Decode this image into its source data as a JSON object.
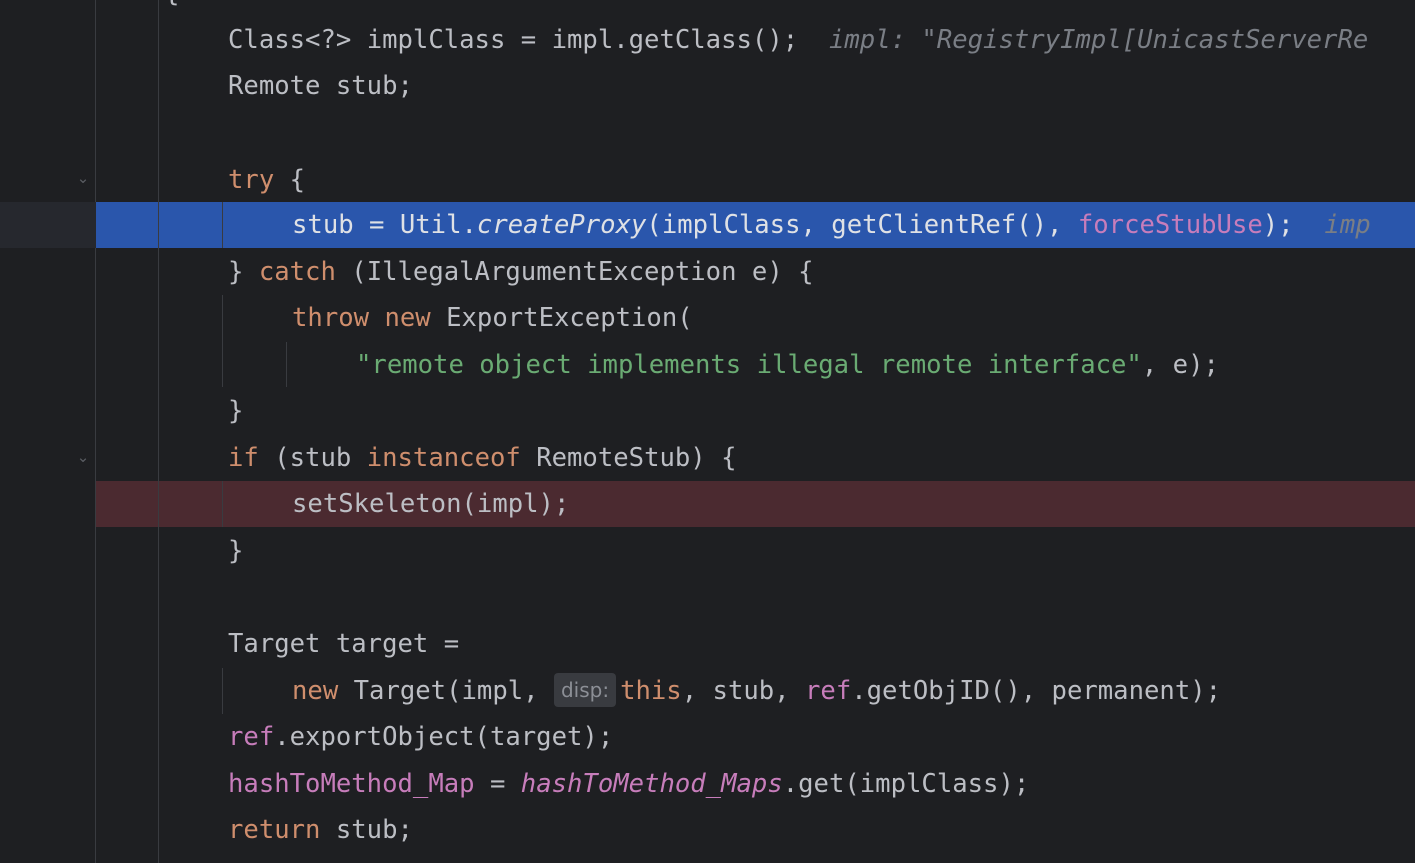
{
  "code": {
    "line_class_decl": {
      "type": "Class<?>",
      "name": " implClass = impl.getClass();",
      "debug_hint": "impl: \"RegistryImpl[UnicastServerRe"
    },
    "line_remote_stub": "Remote stub;",
    "line_try": {
      "kw": "try",
      "rest": " {"
    },
    "line_create_proxy": {
      "prefix": "stub = Util.",
      "method": "createProxy",
      "args": "(implClass, getClientRef(), ",
      "field": "forceStubUse",
      "suffix": ");",
      "debug_hint": "imp"
    },
    "line_catch": {
      "pre": "} ",
      "kw": "catch",
      "rest": " (IllegalArgumentException e) {"
    },
    "line_throw": {
      "kw1": "throw",
      "kw2": "new",
      "rest": " ExportException("
    },
    "line_string": {
      "str": "\"remote object implements illegal remote interface\"",
      "rest": ", e);"
    },
    "line_close1": "}",
    "line_if": {
      "kw1": "if",
      "mid": " (stub ",
      "kw2": "instanceof",
      "rest": " RemoteStub) {"
    },
    "line_set_skeleton": "setSkeleton(impl);",
    "line_close2": "}",
    "line_target_decl": "Target target =",
    "line_new_target": {
      "kw1": "new",
      "pre": " Target(impl, ",
      "param_hint": "disp:",
      "kw2": "this",
      "mid": ", stub, ",
      "field": "ref",
      "rest": ".getObjID(), permanent);"
    },
    "line_export": {
      "field": "ref",
      "rest": ".exportObject(target);"
    },
    "line_hash": {
      "field": "hashToMethod_Map",
      "mid": " = ",
      "static_field": "hashToMethod_Maps",
      "rest": ".get(implClass);"
    },
    "line_return": {
      "kw": "return",
      "rest": " stub;"
    },
    "line_top_brace": "{"
  },
  "icons": {
    "fold_try": "chevron-down-icon",
    "fold_if": "chevron-down-icon"
  },
  "colors": {
    "background": "#1e1f22",
    "execution_highlight": "#2a56ac",
    "breakpoint_highlight": "#4b2a30",
    "keyword": "#cf8e6d",
    "string": "#6aab73",
    "field": "#c77dbb",
    "text": "#bcbec4",
    "hint": "#7a7e85"
  }
}
